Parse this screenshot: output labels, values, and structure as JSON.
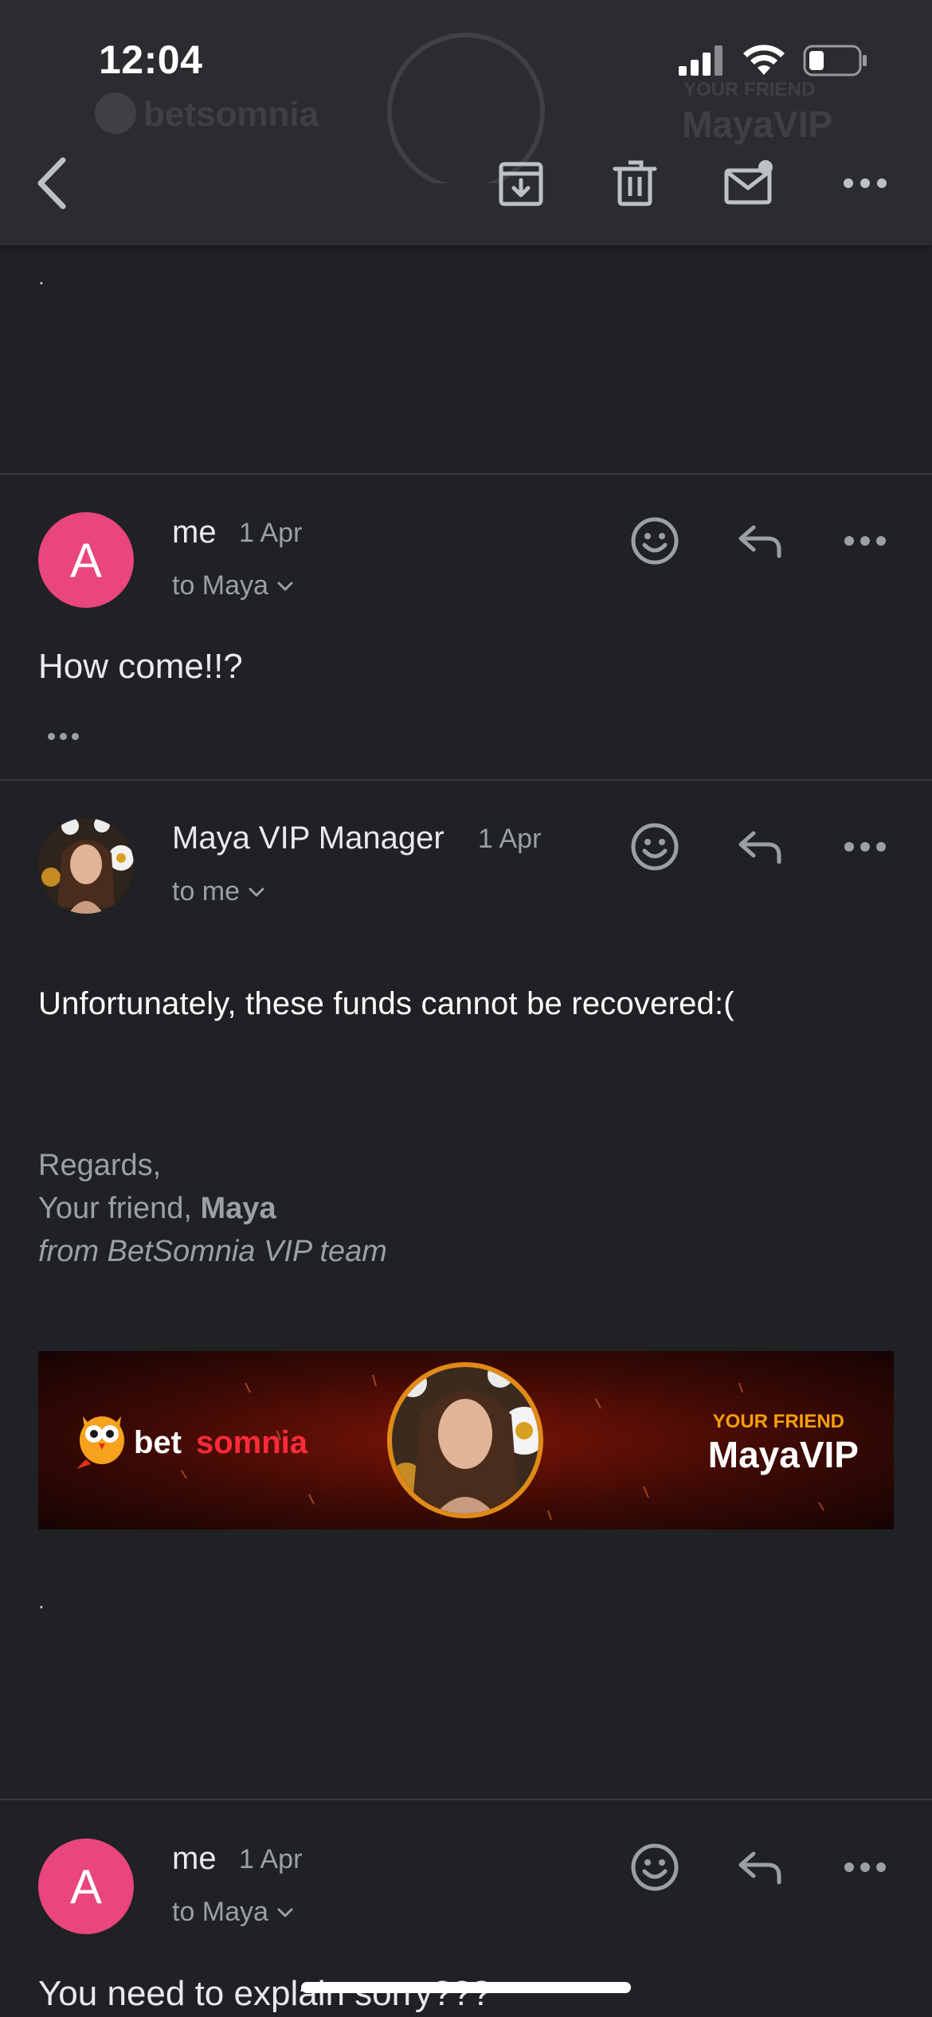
{
  "status_bar": {
    "time": "12:04"
  },
  "header": {
    "icons": [
      "back-arrow-icon",
      "archive-icon",
      "trash-icon",
      "mark-unread-icon",
      "more-icon"
    ],
    "ghost_banner": {
      "friend_label": "YOUR FRIEND",
      "vip_label": "MayaVIP",
      "brand": "betsomnia"
    }
  },
  "top_partial": {
    "trailing_text": "."
  },
  "messages": [
    {
      "avatar_letter": "A",
      "sender": "me",
      "date": "1 Apr",
      "to": "to Maya",
      "body": "How come!!?"
    },
    {
      "sender": "Maya VIP Manager",
      "date": "1 Apr",
      "to": "to me",
      "body": "Unfortunately, these funds cannot be recovered:(",
      "signature": {
        "regards": "Regards,",
        "friend_prefix": "Your friend,",
        "friend_name": "Maya",
        "team": "from BetSomnia VIP team"
      },
      "banner": {
        "brand_a": "bet",
        "brand_b": "somnia",
        "friend_label": "YOUR FRIEND",
        "vip_label": "MayaVIP"
      },
      "trailing_text": "."
    },
    {
      "avatar_letter": "A",
      "sender": "me",
      "date": "1 Apr",
      "to": "to Maya",
      "body": "You need to explain sorry???"
    }
  ],
  "colors": {
    "background": "#202124",
    "header": "#2b2c30",
    "avatar_pink": "#e8467c",
    "secondary_text": "#9aa0a6",
    "brand_red": "#ff2a3a",
    "brand_orange": "#f59e0b"
  }
}
